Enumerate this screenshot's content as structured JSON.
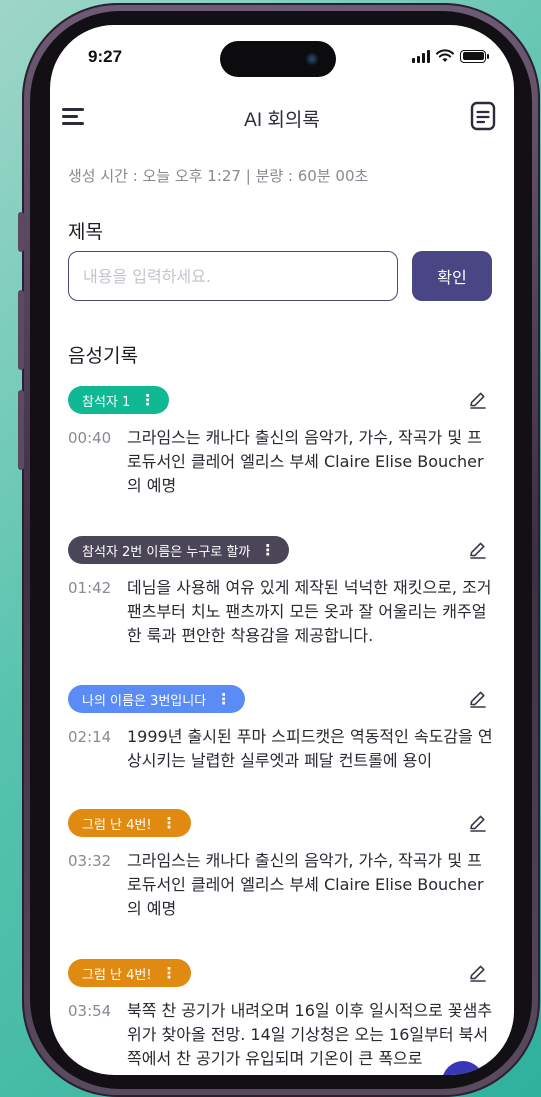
{
  "status_bar": {
    "time": "9:27"
  },
  "header": {
    "title": "AI 회의록"
  },
  "meta_text": "생성 시간 : 오늘 오후 1:27 | 분량 : 60분 00초",
  "title_section": {
    "label": "제목",
    "placeholder": "내용을 입력하세요.",
    "value": "",
    "confirm_label": "확인"
  },
  "records_section_label": "음성기록",
  "records": [
    {
      "speaker": "참석자 1",
      "color": "#10b894",
      "time": "00:40",
      "text": "그라임스는 캐나다 출신의 음악가, 가수, 작곡가 및 프로듀서인 클레어 엘리스 부셰 Claire Elise Boucher 의 예명"
    },
    {
      "speaker": "참석자 2번 이름은 누구로 할까",
      "color": "#4a4658",
      "time": "01:42",
      "text": "데님을 사용해 여유 있게 제작된 넉넉한 재킷으로, 조거 팬츠부터 치노 팬츠까지 모든 옷과 잘 어울리는 캐주얼한 룩과 편안한 착용감을 제공합니다."
    },
    {
      "speaker": "나의 이름은 3번입니다",
      "color": "#5b8cf5",
      "time": "02:14",
      "text": "1999년 출시된 푸마 스피드캣은 역동적인 속도감을 연상시키는 날렵한 실루엣과 페달 컨트롤에 용이"
    },
    {
      "speaker": "그럼 난 4번!",
      "color": "#e08a12",
      "time": "03:32",
      "text": "그라임스는 캐나다 출신의 음악가, 가수, 작곡가 및 프로듀서인 클레어 엘리스 부셰 Claire Elise Boucher 의 예명"
    },
    {
      "speaker": "그럼 난 4번!",
      "color": "#e08a12",
      "time": "03:54",
      "text": "북쪽 찬 공기가 내려오며 16일 이후 일시적으로 꽃샘추위가 찾아올 전망. 14일 기상청은 오는 16일부터 북서쪽에서 찬 공기가 유입되며 기온이 큰 폭으로"
    }
  ],
  "icons": {
    "menu": "hamburger-menu-icon",
    "document": "document-icon",
    "edit": "pencil-icon",
    "more": "vertical-dots-icon"
  },
  "colors": {
    "accent": "#4a4686",
    "title_text": "#2e2a3c",
    "muted_text": "#8a8893"
  }
}
